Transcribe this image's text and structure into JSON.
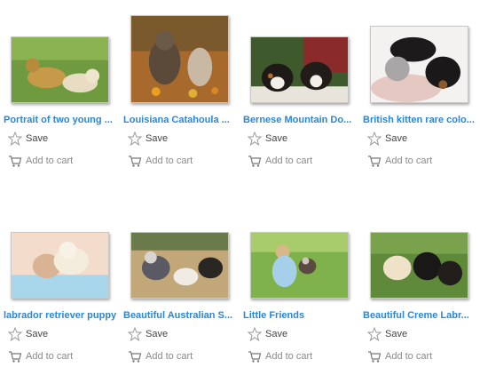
{
  "actions": {
    "save_label": "Save",
    "cart_label": "Add to cart"
  },
  "colors": {
    "title_link": "#2b86d6",
    "save_text": "#444444",
    "cart_text": "#8a8a8a"
  },
  "products": [
    {
      "title": "Portrait of two young ...",
      "scene": "grass-puppies"
    },
    {
      "title": "Louisiana Catahoula ...",
      "scene": "autumn-dogs"
    },
    {
      "title": "Bernese Mountain Do...",
      "scene": "bernese"
    },
    {
      "title": "British kitten rare colo...",
      "scene": "kitten-puppies"
    },
    {
      "title": "labrador retriever puppy",
      "scene": "lab-blanket"
    },
    {
      "title": "Beautiful Australian S...",
      "scene": "aussie-hay"
    },
    {
      "title": "Little Friends",
      "scene": "girl-puppy"
    },
    {
      "title": "Beautiful Creme Labr...",
      "scene": "creme-lab"
    }
  ]
}
